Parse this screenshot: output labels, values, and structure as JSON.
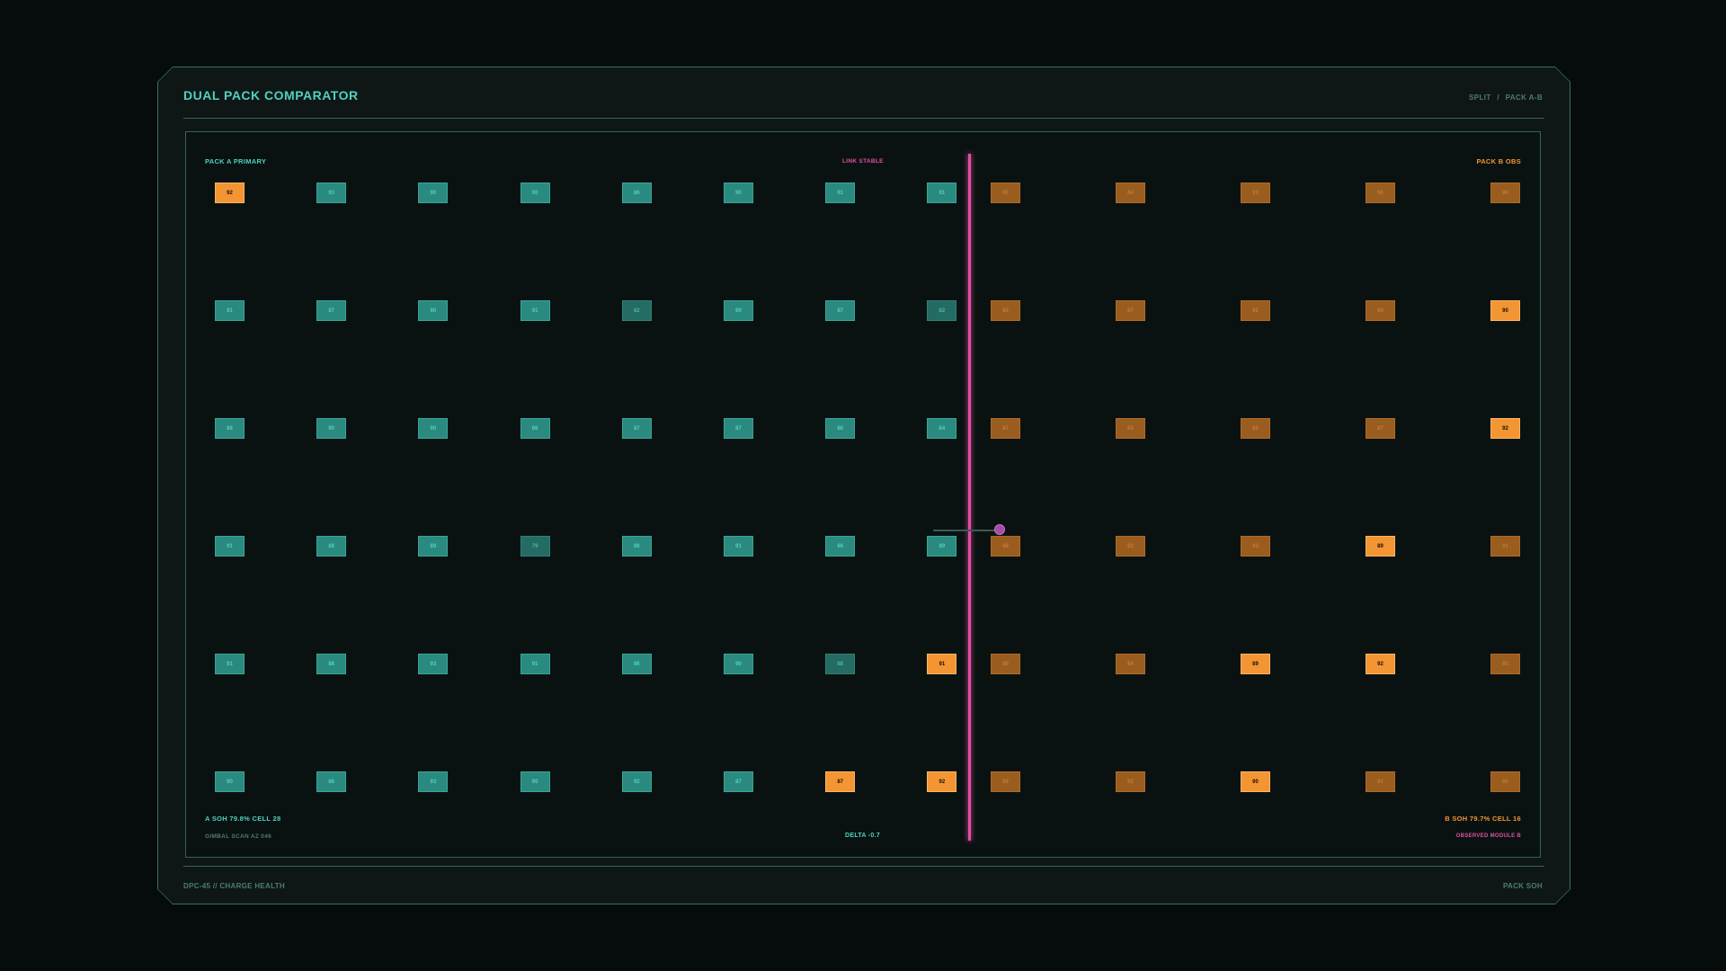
{
  "header": {
    "title": "DUAL PACK COMPARATOR",
    "mode": "SPLIT",
    "separator": "/",
    "pack_pair": "PACK A-B"
  },
  "panel": {
    "pack_a_label": "PACK A  PRIMARY",
    "pack_b_label": "PACK B  OBS",
    "link_status": "LINK STABLE",
    "a_summary": "A SOH 79.8% CELL 28",
    "b_summary": "B SOH 79.7% CELL 16",
    "gimbal": "GIMBAL SCAN AZ 046",
    "delta": "DELTA -0.7",
    "observed": "OBSERVED MODULE B"
  },
  "pack_a": {
    "rows": [
      [
        "92",
        "93",
        "90",
        "90",
        "86",
        "90",
        "91",
        "91"
      ],
      [
        "91",
        "87",
        "90",
        "91",
        "82",
        "90",
        "87",
        "82"
      ],
      [
        "86",
        "90",
        "90",
        "86",
        "87",
        "87",
        "86",
        "84"
      ],
      [
        "91",
        "88",
        "89",
        "79",
        "86",
        "91",
        "86",
        "89"
      ],
      [
        "91",
        "88",
        "93",
        "91",
        "86",
        "90",
        "88",
        "91"
      ],
      [
        "90",
        "86",
        "93",
        "90",
        "92",
        "87",
        "87",
        "92"
      ]
    ],
    "hot": [
      [
        0,
        0
      ],
      [
        4,
        7
      ],
      [
        5,
        6
      ],
      [
        5,
        7
      ]
    ],
    "dark": [
      [
        1,
        4
      ],
      [
        1,
        7
      ],
      [
        3,
        3
      ],
      [
        4,
        6
      ]
    ]
  },
  "pack_b": {
    "rows": [
      [
        "90",
        "84",
        "93",
        "90",
        "90"
      ],
      [
        "85",
        "87",
        "92",
        "89",
        "90"
      ],
      [
        "87",
        "93",
        "89",
        "87",
        "92"
      ],
      [
        "88",
        "92",
        "92",
        "89",
        "91"
      ],
      [
        "89",
        "84",
        "89",
        "92",
        "91"
      ],
      [
        "89",
        "92",
        "90",
        "91",
        "90"
      ]
    ],
    "hot": [
      [
        1,
        4
      ],
      [
        2,
        4
      ],
      [
        3,
        3
      ],
      [
        4,
        2
      ],
      [
        4,
        3
      ],
      [
        5,
        2
      ]
    ]
  },
  "footer": {
    "left": "DPC-45  //  CHARGE HEALTH",
    "right": "PACK SOH"
  },
  "colors": {
    "teal": "#4fd1bf",
    "orange": "#f39533",
    "pink": "#e24fa4",
    "border": "#3b6e63"
  }
}
